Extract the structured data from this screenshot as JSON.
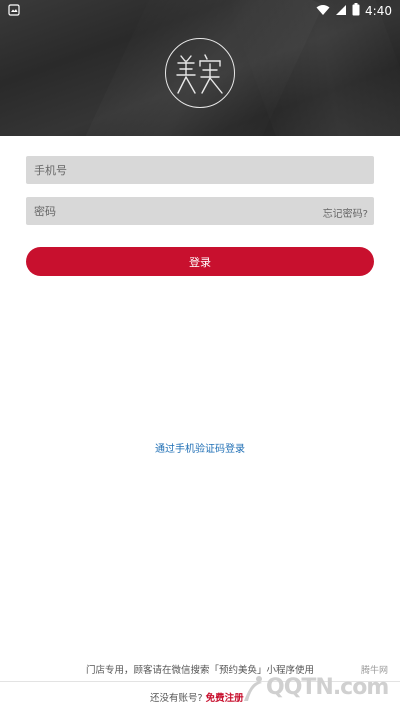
{
  "status_bar": {
    "time": "4:40",
    "icons": [
      "notification-icon",
      "wifi-icon",
      "signal-icon",
      "battery-icon"
    ]
  },
  "header": {
    "logo_glyph": "美奂",
    "logo_icon": "brand-logo-icon"
  },
  "form": {
    "phone_placeholder": "手机号",
    "password_placeholder": "密码",
    "forgot_label": "忘记密码?",
    "login_label": "登录"
  },
  "alt_login": {
    "sms_label": "通过手机验证码登录"
  },
  "footer": {
    "store_note": "门店专用，顾客请在微信搜索「预约美奂」小程序使用",
    "no_account": "还没有账号?",
    "register_label": "免费注册"
  },
  "watermark": {
    "small_text": "腾牛网",
    "big_text": "QQTN.com"
  },
  "colors": {
    "accent": "#c8102e",
    "link": "#1f6fb5",
    "header_bg": "#2e2e2e",
    "field_bg": "#d8d8d8"
  }
}
